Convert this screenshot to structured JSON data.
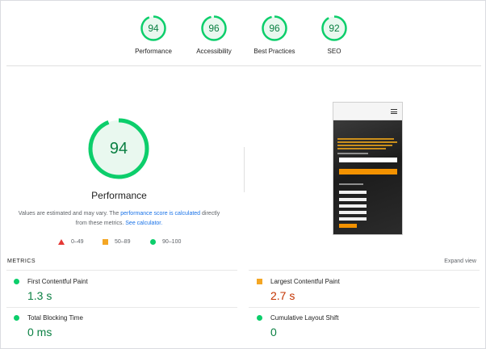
{
  "categories": [
    {
      "label": "Performance",
      "score": 94
    },
    {
      "label": "Accessibility",
      "score": 96
    },
    {
      "label": "Best Practices",
      "score": 96
    },
    {
      "label": "SEO",
      "score": 92
    }
  ],
  "main": {
    "score": 94,
    "title": "Performance",
    "note_prefix": "Values are estimated and may vary. The ",
    "note_link1": "performance score is calculated",
    "note_mid": " directly from these metrics. ",
    "note_link2": "See calculator."
  },
  "legend": {
    "fail": "0–49",
    "average": "50–89",
    "pass": "90–100"
  },
  "metrics": {
    "header": "METRICS",
    "expand": "Expand view",
    "fcp": {
      "label": "First Contentful Paint",
      "value": "1.3 s"
    },
    "lcp": {
      "label": "Largest Contentful Paint",
      "value": "2.7 s"
    },
    "tbt": {
      "label": "Total Blocking Time",
      "value": "0 ms"
    },
    "cls": {
      "label": "Cumulative Layout Shift",
      "value": "0"
    }
  },
  "colors": {
    "pass": "#0cce6b",
    "pass_text": "#0b8043",
    "average": "#f4a624",
    "average_text": "#c33300",
    "fail": "#e53935",
    "link": "#1a73e8"
  }
}
